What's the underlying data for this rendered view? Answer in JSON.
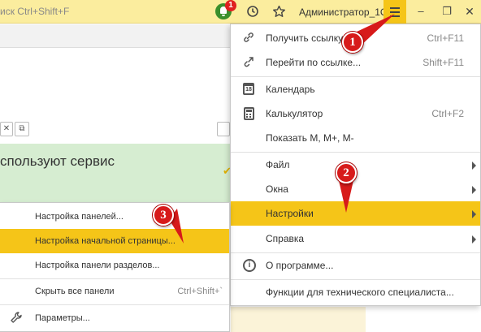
{
  "topbar": {
    "search_hint": "иск Ctrl+Shift+F",
    "notification_count": "1",
    "username": "Администратор_1С",
    "minimize_glyph": "‒",
    "restore_glyph": "❐",
    "close_glyph": "✕"
  },
  "background": {
    "close_btn": "✕",
    "popout_btn": "⧉",
    "banner_text": "спользуют сервис"
  },
  "main_menu": {
    "items": [
      {
        "label": "Получить ссылку...",
        "shortcut": "Ctrl+F11",
        "icon": "link-icon"
      },
      {
        "label": "Перейти по ссылке...",
        "shortcut": "Shift+F11",
        "icon": "goto-link-icon"
      },
      {
        "label": "Календарь",
        "icon": "calendar-icon",
        "icon_text": "18"
      },
      {
        "label": "Калькулятор",
        "shortcut": "Ctrl+F2",
        "icon": "calculator-icon"
      },
      {
        "label": "Показать M, M+, M-"
      },
      {
        "label": "Файл",
        "submenu": true
      },
      {
        "label": "Окна",
        "submenu": true
      },
      {
        "label": "Настройки",
        "submenu": true,
        "active": true
      },
      {
        "label": "Справка",
        "submenu": true
      },
      {
        "label": "О программе...",
        "icon": "info-icon",
        "icon_text": "i"
      },
      {
        "label": "Функции для технического специалиста..."
      }
    ]
  },
  "sub_menu": {
    "items": [
      {
        "label": "Настройка панелей..."
      },
      {
        "label": "Настройка начальной страницы...",
        "active": true
      },
      {
        "label": "Настройка панели разделов..."
      },
      {
        "label": "Скрыть все панели",
        "shortcut": "Ctrl+Shift+`"
      },
      {
        "label": "Параметры...",
        "icon": "wrench-icon"
      }
    ]
  },
  "markers": [
    "1",
    "2",
    "3"
  ],
  "colors": {
    "accent_yellow": "#f5c518",
    "topbar_bg": "#fbed9e",
    "banner_green": "#d6edd1",
    "marker_red": "#d71a1a"
  }
}
